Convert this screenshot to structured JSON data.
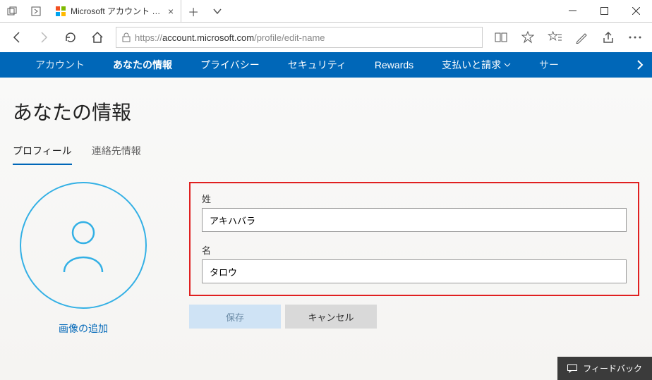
{
  "window": {
    "tab_title": "Microsoft アカウント | 自分"
  },
  "address": {
    "protocol": "https://",
    "host": "account.microsoft.com",
    "path": "/profile/edit-name"
  },
  "nav": {
    "items": [
      "アカウント",
      "あなたの情報",
      "プライバシー",
      "セキュリティ",
      "Rewards",
      "支払いと請求",
      "サー"
    ],
    "active_index": 1,
    "more_after_index": 5
  },
  "page": {
    "title": "あなたの情報",
    "tabs": [
      "プロフィール",
      "連絡先情報"
    ],
    "active_tab": 0,
    "avatar_link": "画像の追加"
  },
  "form": {
    "last_name_label": "姓",
    "last_name_value": "アキハバラ",
    "first_name_label": "名",
    "first_name_value": "タロウ",
    "save_label": "保存",
    "cancel_label": "キャンセル"
  },
  "feedback": {
    "label": "フィードバック"
  }
}
